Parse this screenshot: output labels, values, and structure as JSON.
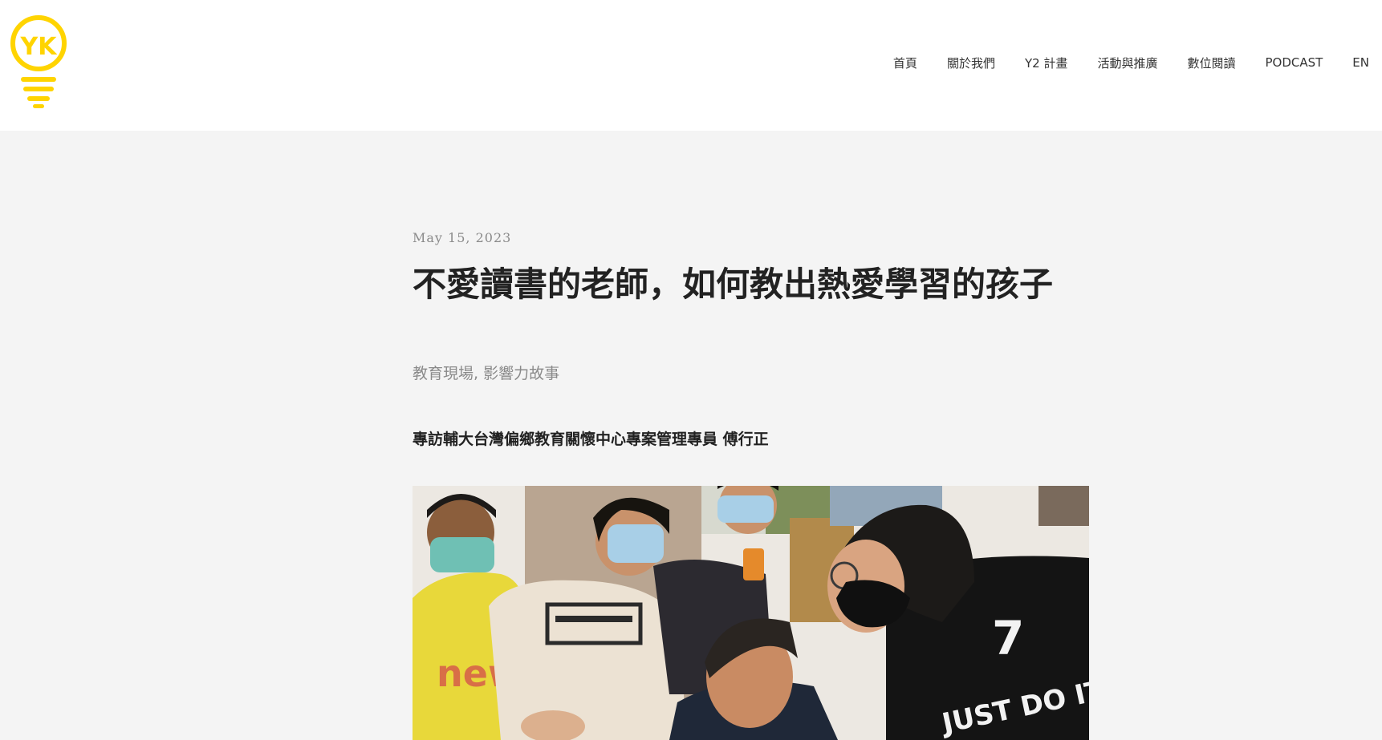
{
  "header": {
    "logo_label": "YK",
    "nav": [
      "首頁",
      "關於我們",
      "Y2 計畫",
      "活動與推廣",
      "數位閱讀",
      "PODCAST",
      "EN"
    ]
  },
  "article": {
    "date": "May 15, 2023",
    "title": "不愛讀書的老師，如何教出熱愛學習的孩子",
    "categories": [
      "教育現場",
      "影響力故事"
    ],
    "category_separator": ", ",
    "subhead": "專訪輔大台灣偏鄉教育關懷中心專案管理專員 傅行正",
    "image_shirt_text": "JUST DO IT.",
    "image_shirt_number": "7"
  },
  "colors": {
    "brand_yellow": "#FFD400",
    "page_bg": "#f4f4f4",
    "header_bg": "#ffffff"
  }
}
